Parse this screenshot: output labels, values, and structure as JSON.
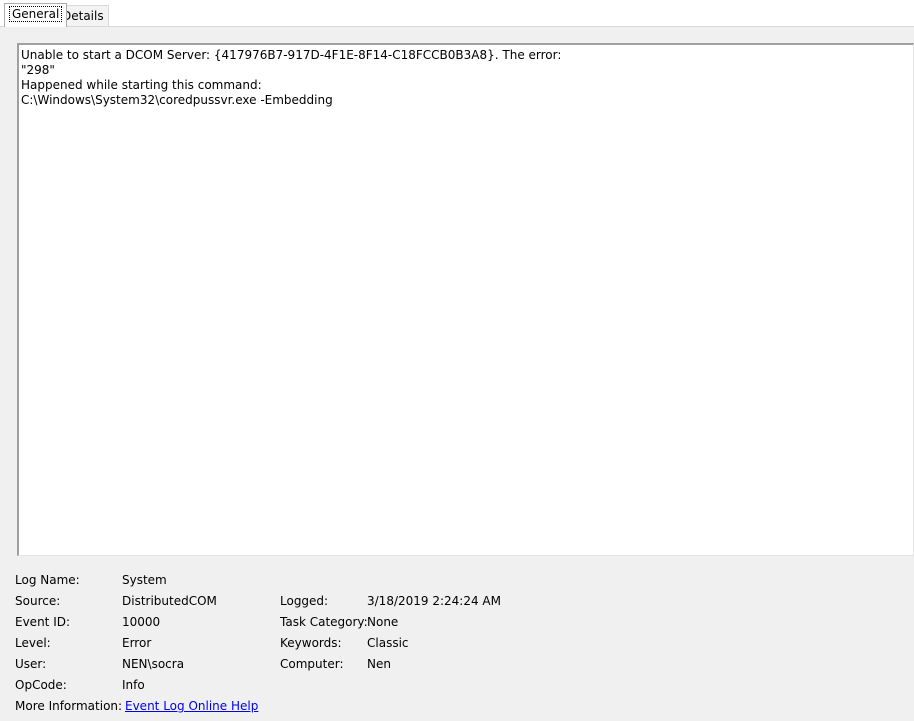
{
  "tabs": [
    {
      "label": "General",
      "active": true
    },
    {
      "label": "Details",
      "active": false
    }
  ],
  "description": {
    "lines": [
      "Unable to start a DCOM Server: {417976B7-917D-4F1E-8F14-C18FCCB0B3A8}. The error:",
      "\"298\"",
      "Happened while starting this command:",
      "C:\\Windows\\System32\\coredpussvr.exe -Embedding"
    ]
  },
  "fields": {
    "log_name": {
      "label": "Log Name:",
      "value": "System"
    },
    "source": {
      "label": "Source:",
      "value": "DistributedCOM"
    },
    "logged": {
      "label": "Logged:",
      "value": "3/18/2019 2:24:24 AM"
    },
    "event_id": {
      "label": "Event ID:",
      "value": "10000"
    },
    "task_category": {
      "label": "Task Category:",
      "value": "None"
    },
    "level": {
      "label": "Level:",
      "value": "Error"
    },
    "keywords": {
      "label": "Keywords:",
      "value": "Classic"
    },
    "user": {
      "label": "User:",
      "value": "NEN\\socra"
    },
    "computer": {
      "label": "Computer:",
      "value": "Nen"
    },
    "opcode": {
      "label": "OpCode:",
      "value": "Info"
    },
    "more_info": {
      "label": "More Information:",
      "link": "Event Log Online Help"
    }
  },
  "colors": {
    "link": "#0000ee",
    "panel_background": "#f0f0f0"
  }
}
